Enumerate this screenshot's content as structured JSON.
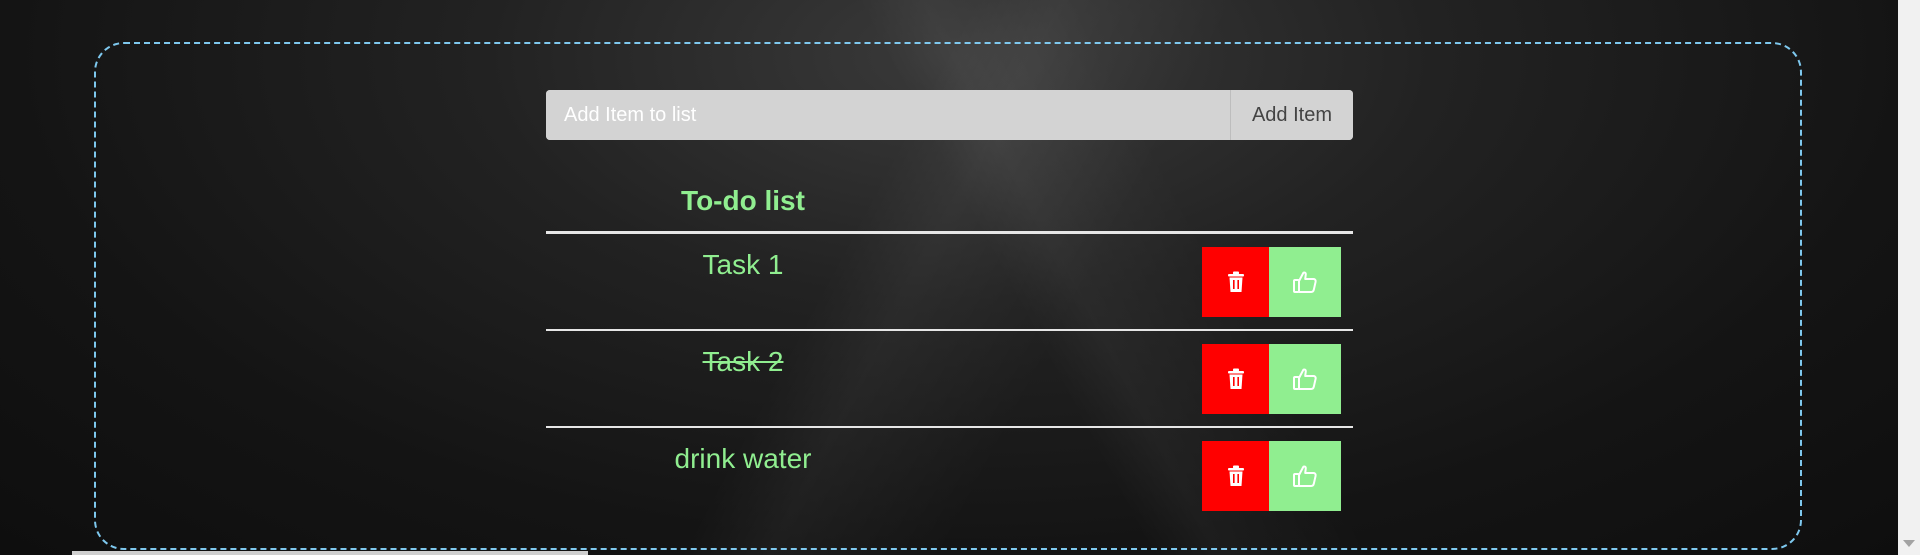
{
  "form": {
    "input_placeholder": "Add Item to list",
    "input_value": "",
    "add_button_label": "Add Item"
  },
  "list": {
    "title": "To-do list",
    "items": [
      {
        "text": "Task 1",
        "completed": false
      },
      {
        "text": "Task 2",
        "completed": true
      },
      {
        "text": "drink water",
        "completed": false
      }
    ]
  },
  "colors": {
    "accent_green": "#90ee90",
    "delete_red": "#ff0000",
    "frame_border": "#7ec8ee",
    "input_bg": "#d3d3d3"
  },
  "icons": {
    "delete": "trash-icon",
    "complete": "thumbs-up-icon"
  }
}
